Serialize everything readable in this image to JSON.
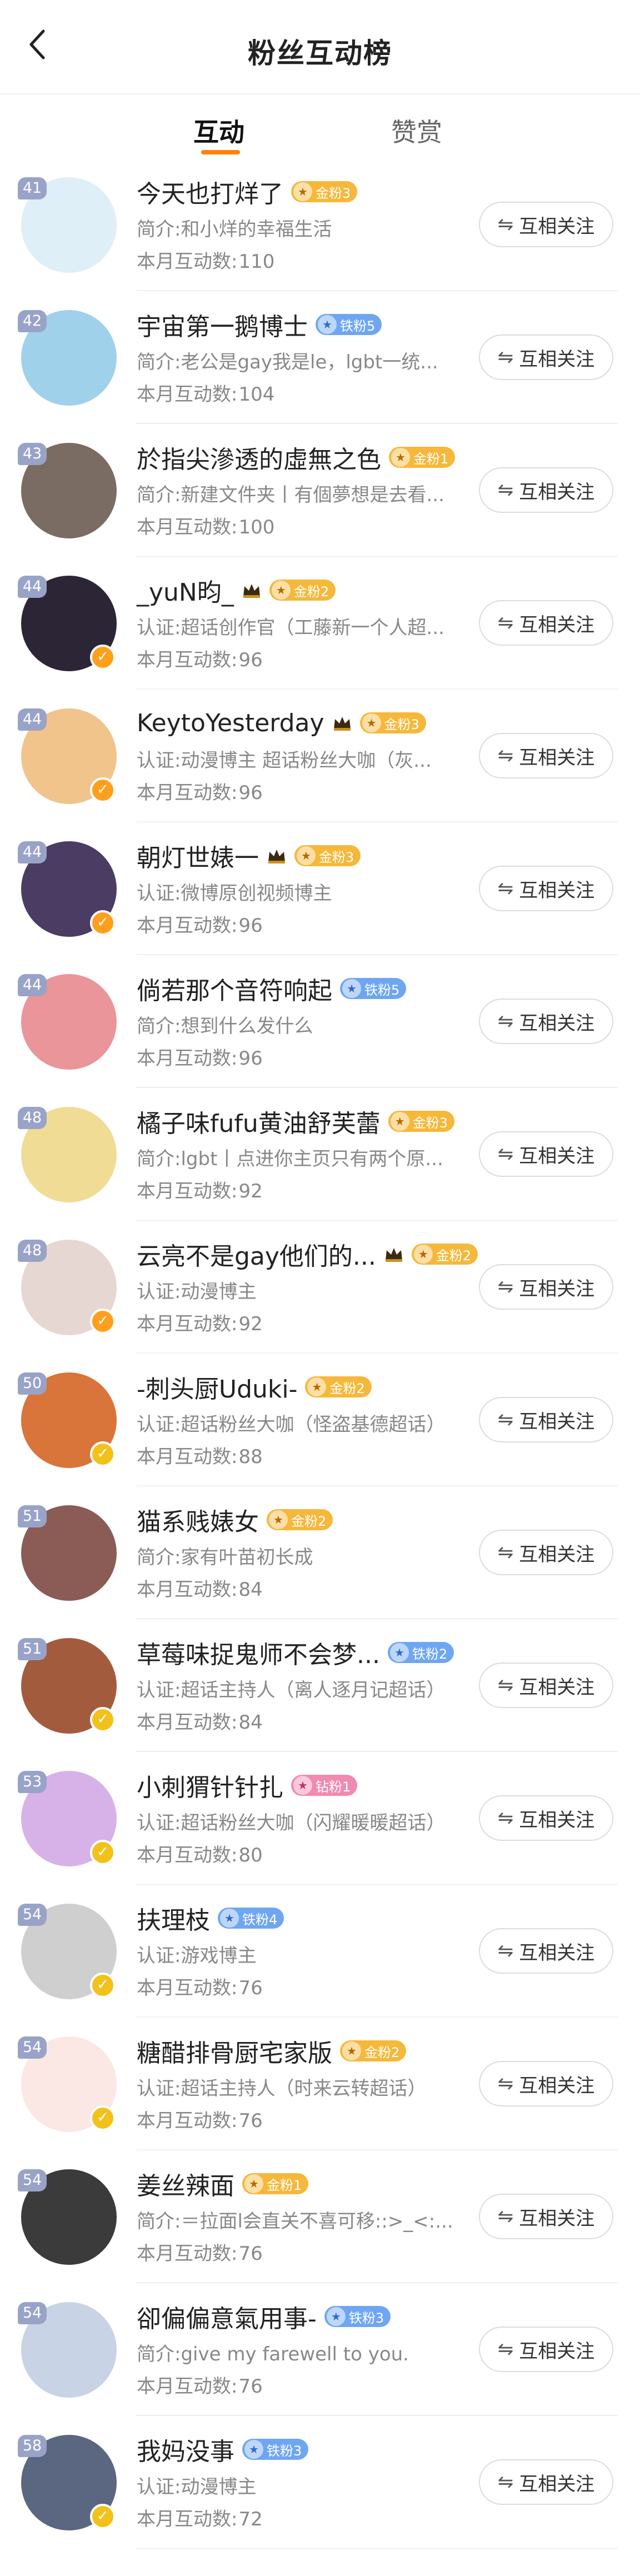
{
  "header": {
    "title": "粉丝互动榜"
  },
  "tabs": [
    {
      "label": "互动",
      "active": true
    },
    {
      "label": "赞赏",
      "active": false
    }
  ],
  "follow_label": "互相关注",
  "count_label": "本月互动数:",
  "colors": {
    "accent": "#ff8200",
    "rank_badge": "#99a3c8",
    "gold_badge": "#f5b83a",
    "blue_badge": "#6fa6f2"
  },
  "rows": [
    {
      "rank": "41",
      "name": "今天也打烊了",
      "badge": "金粉3",
      "badge_color": "gold",
      "bio": "简介:和小烊的幸福生活",
      "count": "110",
      "vbadge": "",
      "avatar_color": "#dfeff7"
    },
    {
      "rank": "42",
      "name": "宇宙第一鹅博士",
      "badge": "铁粉5",
      "badge_color": "blue",
      "bio": "简介:老公是gay我是le，lgbt一统...",
      "count": "104",
      "vbadge": "",
      "avatar_color": "#9fd1ea"
    },
    {
      "rank": "43",
      "name": "於指尖滲透的虛無之色",
      "badge": "金粉1",
      "badge_color": "gold",
      "bio": "简介:新建文件夹丨有個夢想是去看...",
      "count": "100",
      "vbadge": "",
      "avatar_color": "#7a6b63"
    },
    {
      "rank": "44",
      "name": "_yuN昀_",
      "badge": "金粉2",
      "badge_color": "gold",
      "crown": true,
      "bio": "认证:超话创作官（工藤新一个人超...",
      "count": "96",
      "vbadge": "orange",
      "avatar_color": "#2b2536"
    },
    {
      "rank": "44",
      "name": "KeytoYesterday",
      "badge": "金粉3",
      "badge_color": "gold",
      "crown": true,
      "bio": "认证:动漫博主 超话粉丝大咖（灰...",
      "count": "96",
      "vbadge": "orange",
      "avatar_color": "#f0c48a"
    },
    {
      "rank": "44",
      "name": "朝灯世婊一",
      "badge": "金粉3",
      "badge_color": "gold",
      "crown": true,
      "bio": "认证:微博原创视频博主",
      "count": "96",
      "vbadge": "orange",
      "avatar_color": "#4a3c63"
    },
    {
      "rank": "44",
      "name": "倘若那个音符响起",
      "badge": "铁粉5",
      "badge_color": "blue",
      "bio": "简介:想到什么发什么",
      "count": "96",
      "vbadge": "",
      "avatar_color": "#e9959a"
    },
    {
      "rank": "48",
      "name": "橘子味fufu黄油舒芙蕾",
      "badge": "金粉3",
      "badge_color": "gold",
      "bio": "简介:lgbt丨点进你主页只有两个原...",
      "count": "92",
      "vbadge": "",
      "avatar_color": "#f1dc95"
    },
    {
      "rank": "48",
      "name": "云亮不是gay他们的...",
      "badge": "金粉2",
      "badge_color": "gold",
      "crown": true,
      "bio": "认证:动漫博主",
      "count": "92",
      "vbadge": "orange",
      "avatar_color": "#e6d7d2"
    },
    {
      "rank": "50",
      "name": "-刺头厨Uduki-",
      "badge": "金粉2",
      "badge_color": "gold",
      "bio": "认证:超话粉丝大咖（怪盗基德超话）",
      "count": "88",
      "vbadge": "gold",
      "avatar_color": "#d9743a"
    },
    {
      "rank": "51",
      "name": "猫系贱婊女",
      "badge": "金粉2",
      "badge_color": "gold",
      "bio": "简介:家有叶苗初长成",
      "count": "84",
      "vbadge": "",
      "avatar_color": "#8a5c55"
    },
    {
      "rank": "51",
      "name": "草莓味捉鬼师不会梦...",
      "badge": "铁粉2",
      "badge_color": "blue",
      "bio": "认证:超话主持人（离人逐月记超话）",
      "count": "84",
      "vbadge": "gold",
      "avatar_color": "#a35b3d"
    },
    {
      "rank": "53",
      "name": "小刺猬针针扎",
      "badge": "钻粉1",
      "badge_color": "pink",
      "bio": "认证:超话粉丝大咖（闪耀暖暖超话）",
      "count": "80",
      "vbadge": "gold",
      "avatar_color": "#d7b2e8"
    },
    {
      "rank": "54",
      "name": "扶理枝",
      "badge": "铁粉4",
      "badge_color": "blue",
      "bio": "认证:游戏博主",
      "count": "76",
      "vbadge": "gold",
      "avatar_color": "#cfcfcf"
    },
    {
      "rank": "54",
      "name": "糖醋排骨厨宅家版",
      "badge": "金粉2",
      "badge_color": "gold",
      "bio": "认证:超话主持人（时来云转超话）",
      "count": "76",
      "vbadge": "gold",
      "avatar_color": "#fbe7e4"
    },
    {
      "rank": "54",
      "name": "姜丝辣面",
      "badge": "金粉1",
      "badge_color": "gold",
      "bio": "简介:＝拉面l会直关不喜可移::>_<:...",
      "count": "76",
      "vbadge": "",
      "avatar_color": "#3b3b3b"
    },
    {
      "rank": "54",
      "name": "卻偏偏意氣用事-",
      "badge": "铁粉3",
      "badge_color": "blue",
      "bio": "简介:give my farewell to you.",
      "count": "76",
      "vbadge": "",
      "avatar_color": "#c9d3e6"
    },
    {
      "rank": "58",
      "name": "我妈没事",
      "badge": "铁粉3",
      "badge_color": "blue",
      "bio": "认证:动漫博主",
      "count": "72",
      "vbadge": "gold",
      "avatar_color": "#5b6680"
    }
  ]
}
